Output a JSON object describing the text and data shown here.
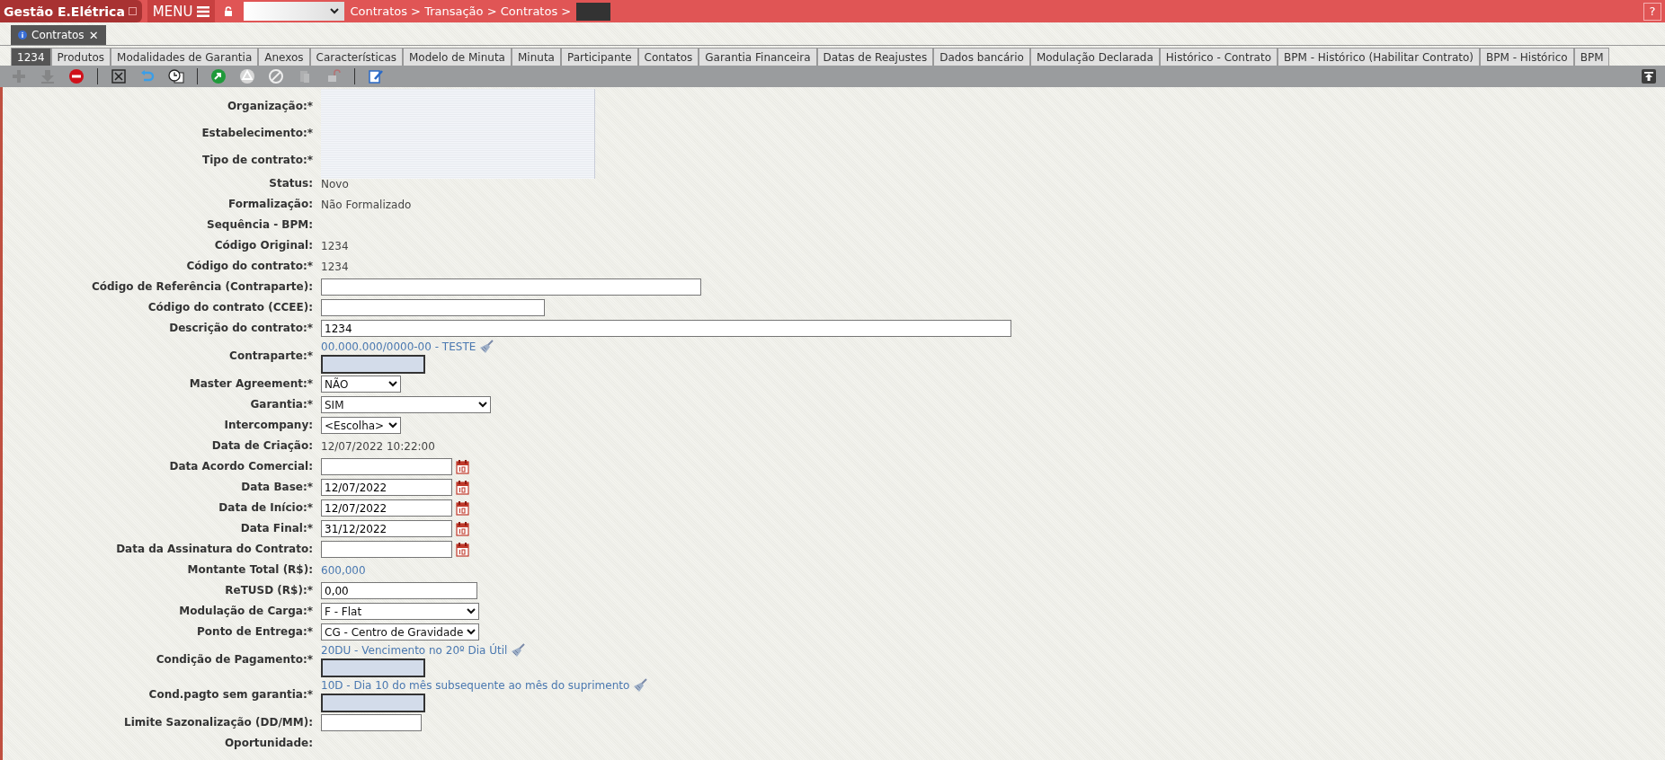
{
  "app": {
    "title": "Gestão E.Elétrica",
    "menu": "MENU",
    "breadcrumb": "Contratos > Transação > Contratos >",
    "help": "?"
  },
  "doc_tabs": [
    {
      "label": "Contratos",
      "close": "✕",
      "selected": true
    }
  ],
  "tabs": [
    {
      "label": "1234",
      "selected": true
    },
    {
      "label": "Produtos",
      "selected": false
    },
    {
      "label": "Modalidades de Garantia",
      "selected": false
    },
    {
      "label": "Anexos",
      "selected": false
    },
    {
      "label": "Características",
      "selected": false
    },
    {
      "label": "Modelo de Minuta",
      "selected": false
    },
    {
      "label": "Minuta",
      "selected": false
    },
    {
      "label": "Participante",
      "selected": false
    },
    {
      "label": "Contatos",
      "selected": false
    },
    {
      "label": "Garantia Financeira",
      "selected": false
    },
    {
      "label": "Datas de Reajustes",
      "selected": false
    },
    {
      "label": "Dados bancário",
      "selected": false
    },
    {
      "label": "Modulação Declarada",
      "selected": false
    },
    {
      "label": "Histórico - Contrato",
      "selected": false
    },
    {
      "label": "BPM - Histórico (Habilitar Contrato)",
      "selected": false
    },
    {
      "label": "BPM - Histórico",
      "selected": false
    },
    {
      "label": "BPM",
      "selected": false
    }
  ],
  "toolbar": [
    {
      "kind": "add",
      "disabled": true
    },
    {
      "kind": "down",
      "disabled": true
    },
    {
      "kind": "stop",
      "disabled": false
    },
    {
      "kind": "sep"
    },
    {
      "kind": "cancel",
      "disabled": false
    },
    {
      "kind": "undo",
      "disabled": false
    },
    {
      "kind": "history",
      "disabled": false
    },
    {
      "kind": "sep"
    },
    {
      "kind": "approve",
      "disabled": false
    },
    {
      "kind": "warning",
      "disabled": false
    },
    {
      "kind": "block",
      "disabled": false
    },
    {
      "kind": "copy",
      "disabled": true
    },
    {
      "kind": "unlock",
      "disabled": true
    },
    {
      "kind": "sep"
    },
    {
      "kind": "edit",
      "disabled": false
    }
  ],
  "fields": [
    {
      "label": "Organização:*",
      "kind": "hidden"
    },
    {
      "label": "Estabelecimento:*",
      "kind": "hidden"
    },
    {
      "label": "Tipo de contrato:*",
      "kind": "hidden"
    },
    {
      "label": "Status:",
      "kind": "text",
      "value": "Novo"
    },
    {
      "label": "Formalização:",
      "kind": "text",
      "value": "Não Formalizado"
    },
    {
      "label": "Sequência - BPM:",
      "kind": "text"
    },
    {
      "label": "Código Original:",
      "kind": "text",
      "value": "1234"
    },
    {
      "label": "Código do contrato:*",
      "kind": "text",
      "value": "1234"
    },
    {
      "label": "Código de Referência (Contraparte):",
      "kind": "lfield"
    },
    {
      "label": "Código do contrato (CCEE):",
      "kind": "mfield"
    },
    {
      "label": "Descrição do contrato:*",
      "kind": "xlfield",
      "value": "1234"
    },
    {
      "label": "Contraparte:*",
      "kind": "lookup",
      "value": "00.000.000/0000-00 - TESTE"
    },
    {
      "label": "Master Agreement:*",
      "kind": "select",
      "value": "NÃO"
    },
    {
      "label": "Garantia:*",
      "kind": "wideselect",
      "value": "SIM"
    },
    {
      "label": "Intercompany:",
      "kind": "select",
      "value": "<Escolha>"
    },
    {
      "label": "Data de Criação:",
      "kind": "text",
      "value": "12/07/2022 10:22:00"
    },
    {
      "label": "Data Acordo Comercial:",
      "kind": "date"
    },
    {
      "label": "Data Base:*",
      "kind": "date",
      "value": "12/07/2022"
    },
    {
      "label": "Data de Início:*",
      "kind": "date",
      "value": "12/07/2022"
    },
    {
      "label": "Data Final:*",
      "kind": "date",
      "value": "31/12/2022"
    },
    {
      "label": "Data da Assinatura do Contrato:",
      "kind": "date"
    },
    {
      "label": "Montante Total (R$):",
      "kind": "amount",
      "value": "600,000"
    },
    {
      "label": "ReTUSD (R$):*",
      "kind": "sfield",
      "value": "0,00"
    },
    {
      "label": "Modulação de Carga:*",
      "kind": "midselect",
      "value": "F - Flat"
    },
    {
      "label": "Ponto de Entrega:*",
      "kind": "select",
      "value": "CG - Centro de Gravidade"
    },
    {
      "label": "Condição de Pagamento:*",
      "kind": "lookup",
      "value": "20DU - Vencimento no 20º Dia Útil"
    },
    {
      "label": "Cond.pagto sem garantia:*",
      "kind": "lookup",
      "value": "10D - Dia 10 do mês subsequente ao mês do suprimento"
    },
    {
      "label": "Limite Sazonalização (DD/MM):",
      "kind": "xsfield"
    },
    {
      "label": "Oportunidade:",
      "kind": "text"
    }
  ]
}
